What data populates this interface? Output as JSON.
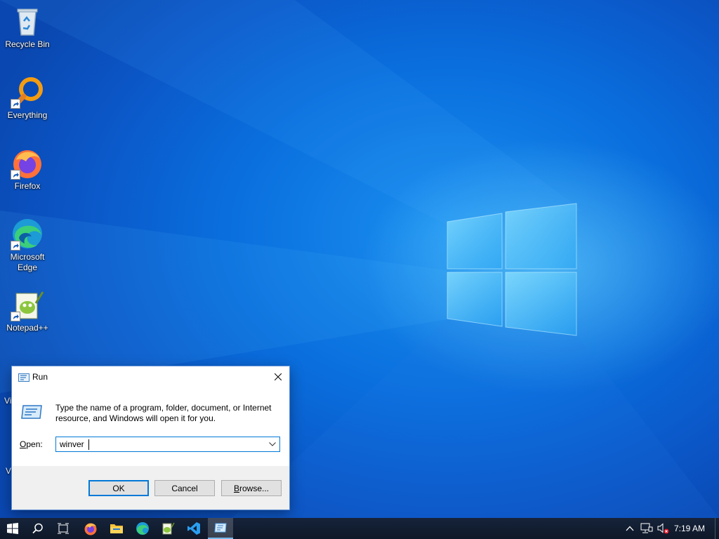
{
  "desktop": {
    "icons": [
      {
        "label": "Recycle Bin",
        "icon": "recycle-bin-icon"
      },
      {
        "label": "Everything",
        "icon": "everything-search-icon"
      },
      {
        "label": "Firefox",
        "icon": "firefox-icon"
      },
      {
        "label": "Microsoft Edge",
        "icon": "edge-icon"
      },
      {
        "label": "Notepad++",
        "icon": "notepad-plus-plus-icon"
      }
    ],
    "partial_labels": [
      "Vi",
      "V"
    ]
  },
  "run_dialog": {
    "title": "Run",
    "description": "Type the name of a program, folder, document, or Internet resource, and Windows will open it for you.",
    "open_label_accel": "O",
    "open_label_rest": "pen:",
    "input_value": "winver",
    "ok_label": "OK",
    "cancel_label": "Cancel",
    "browse_accel": "B",
    "browse_rest": "rowse..."
  },
  "taskbar": {
    "pinned": [
      "start-icon",
      "search-icon",
      "task-view-icon",
      "firefox-icon",
      "file-explorer-icon",
      "edge-icon",
      "notepad-plus-plus-icon",
      "vscode-icon",
      "run-icon"
    ],
    "active_item": "run-icon",
    "tray": [
      "chevron-up-icon",
      "network-icon",
      "volume-muted-icon"
    ],
    "clock": "7:19 AM"
  },
  "colors": {
    "accent": "#0078d7",
    "taskbar": "#101b2c",
    "wallpaper": "#0a6fdd"
  }
}
